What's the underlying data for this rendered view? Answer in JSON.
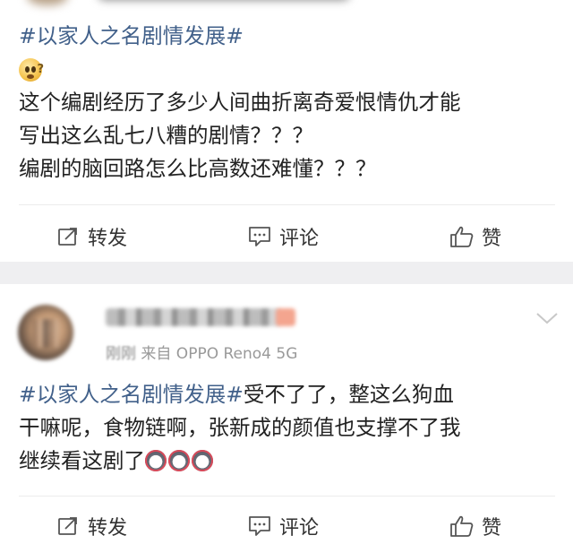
{
  "post1": {
    "hashtag": "#以家人之名剧情发展#",
    "body_lines": [
      "这个编剧经历了多少人间曲折离奇爱恨情仇才能",
      "写出这么乱七八糟的剧情？？？",
      "编剧的脑回路怎么比高数还难懂？？？"
    ],
    "emoji": "thinking-face-icon"
  },
  "post2": {
    "meta_time": "刚刚",
    "meta_source": "来自 OPPO Reno4 5G",
    "hashtag": "#以家人之名剧情发展#",
    "body_lines": [
      "受不了了，整这么狗血",
      "干嘛呢，食物链啊，张新成的颜值也支撑不了我",
      "继续看这剧了"
    ],
    "emoji_count": 3
  },
  "actions": {
    "repost": "转发",
    "comment": "评论",
    "like": "赞"
  },
  "colors": {
    "hashtag": "#41608a",
    "text": "#222222",
    "meta": "#999999",
    "separator": "#efeff1"
  }
}
